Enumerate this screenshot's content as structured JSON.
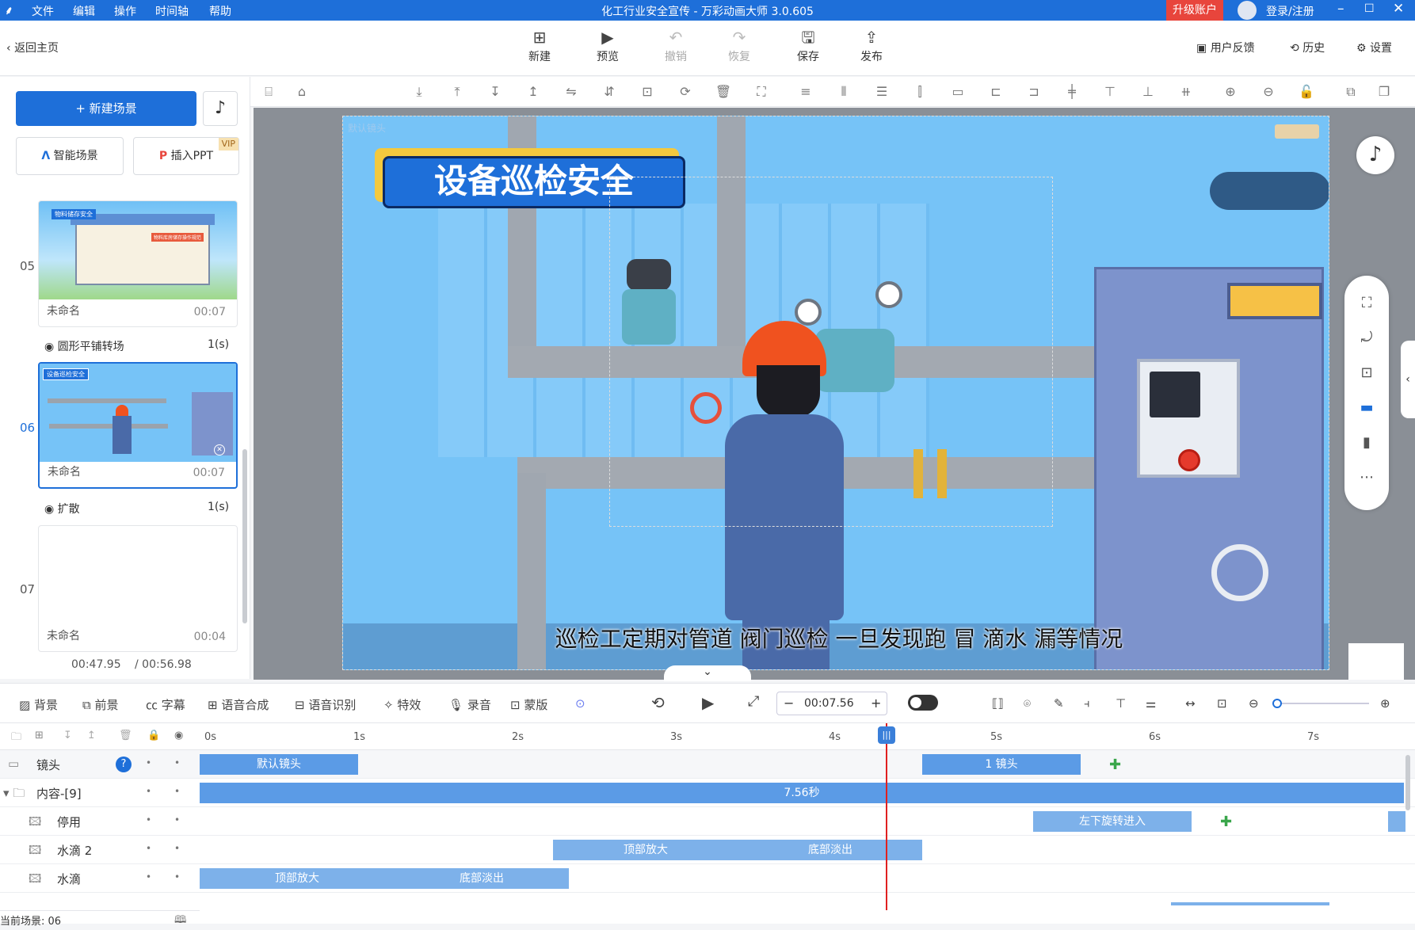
{
  "titlebar": {
    "menus": [
      "文件",
      "编辑",
      "操作",
      "时间轴",
      "帮助"
    ],
    "title": "化工行业安全宣传 - 万彩动画大师 3.0.605",
    "upgrade": "升级账户",
    "login": "登录/注册"
  },
  "toolbar": {
    "back": "返回主页",
    "new": "新建",
    "preview": "预览",
    "undo": "撤销",
    "redo": "恢复",
    "save": "保存",
    "publish": "发布",
    "feedback": "用户反馈",
    "history": "历史",
    "settings": "设置"
  },
  "left": {
    "new_scene": "+ 新建场景",
    "smart_scene": "智能场景",
    "insert_ppt": "插入PPT",
    "vip": "VIP",
    "scenes": [
      {
        "num": "05",
        "name": "未命名",
        "duration": "00:07",
        "thumb_title": "物料储存安全",
        "thumb_sub": "物料库房储存操作规范"
      },
      {
        "num": "06",
        "name": "未命名",
        "duration": "00:07",
        "thumb_title": "设备巡检安全"
      },
      {
        "num": "07",
        "name": "未命名",
        "duration": "00:04"
      }
    ],
    "transitions": [
      {
        "name": "圆形平铺转场",
        "duration": "1(s)"
      },
      {
        "name": "扩散",
        "duration": "1(s)"
      }
    ],
    "time_current": "00:47.95",
    "time_total": "/ 00:56.98"
  },
  "canvas": {
    "camera_label": "默认镜头",
    "title": "设备巡检安全",
    "subtitle": "巡检工定期对管道 阀门巡检 一旦发现跑 冒 滴水 漏等情况"
  },
  "timeline_tools": {
    "bg": "背景",
    "fg": "前景",
    "caption": "字幕",
    "tts": "语音合成",
    "asr": "语音识别",
    "fx": "特效",
    "record": "录音",
    "mask": "蒙版",
    "time": "00:07.56"
  },
  "timeline": {
    "ticks": [
      "0s",
      "1s",
      "2s",
      "3s",
      "4s",
      "5s",
      "6s",
      "7s"
    ],
    "playhead_seconds": 4.33,
    "rows": [
      {
        "label": "镜头",
        "bars": [
          {
            "text": "默认镜头"
          },
          {
            "text": "1 镜头"
          }
        ]
      },
      {
        "label": "内容-[9]",
        "bars": [
          {
            "text": "7.56秒"
          }
        ]
      },
      {
        "label": "停用",
        "bars": [
          {
            "text": "左下旋转进入"
          }
        ]
      },
      {
        "label": "水滴 2",
        "bars": [
          {
            "text": "顶部放大"
          },
          {
            "text": "底部淡出"
          }
        ]
      },
      {
        "label": "水滴",
        "bars": [
          {
            "text": "顶部放大"
          },
          {
            "text": "底部淡出"
          }
        ]
      }
    ],
    "current_scene": "当前场景: 06"
  },
  "colors": {
    "accent": "#1e6fd9",
    "upgrade": "#e8453c",
    "bar": "#5b9be6",
    "playhead": "#e02020",
    "canvas_bg": "#76c3f7"
  }
}
